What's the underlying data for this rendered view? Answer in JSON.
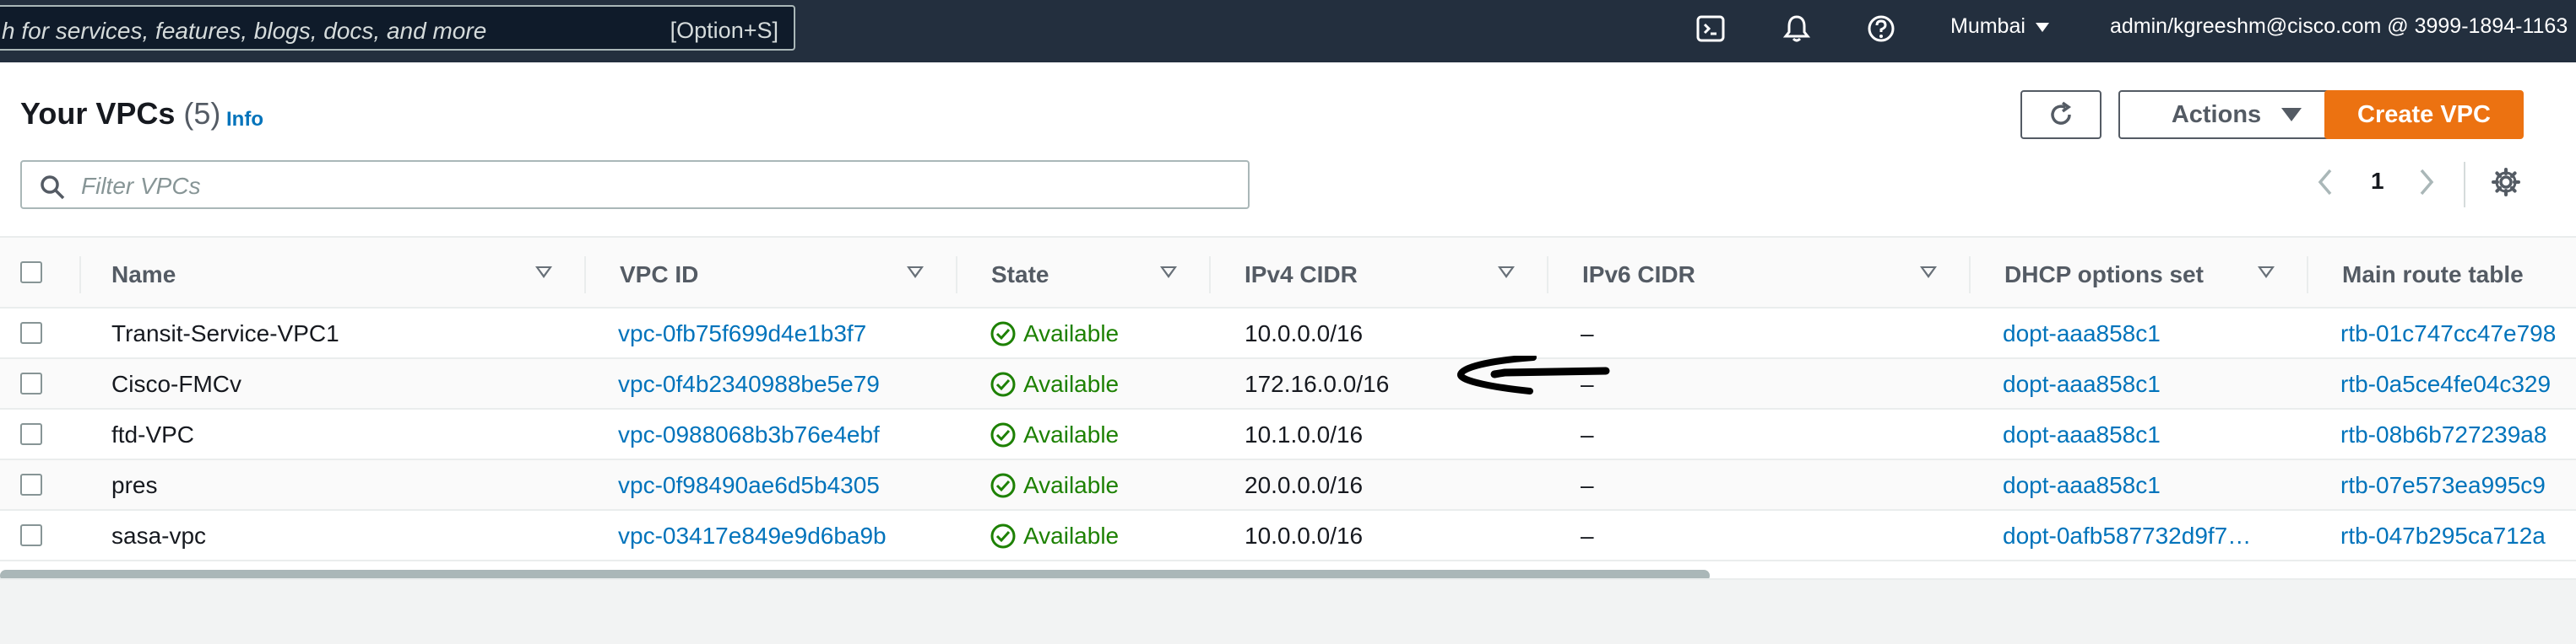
{
  "topnav": {
    "search_placeholder": "h for services, features, blogs, docs, and more",
    "search_shortcut": "[Option+S]",
    "region": "Mumbai",
    "account": "admin/kgreeshm@cisco.com @ 3999-1894-1163",
    "icons": [
      "cloudshell-icon",
      "notifications-icon",
      "help-icon"
    ]
  },
  "header": {
    "title": "Your VPCs",
    "count": "(5)",
    "info": "Info"
  },
  "actions": {
    "refresh": "refresh-icon",
    "actions_label": "Actions",
    "create_label": "Create VPC"
  },
  "filter": {
    "placeholder": "Filter VPCs"
  },
  "pagination": {
    "page": "1"
  },
  "table": {
    "columns": [
      "Name",
      "VPC ID",
      "State",
      "IPv4 CIDR",
      "IPv6 CIDR",
      "DHCP options set",
      "Main route table"
    ],
    "rows": [
      {
        "name": "Transit-Service-VPC1",
        "vpc_id": "vpc-0fb75f699d4e1b3f7",
        "state": "Available",
        "ipv4": "10.0.0.0/16",
        "ipv6": "–",
        "dhcp": "dopt-aaa858c1",
        "route": "rtb-01c747cc47e798"
      },
      {
        "name": "Cisco-FMCv",
        "vpc_id": "vpc-0f4b2340988be5e79",
        "state": "Available",
        "ipv4": "172.16.0.0/16",
        "ipv6": "–",
        "dhcp": "dopt-aaa858c1",
        "route": "rtb-0a5ce4fe04c329"
      },
      {
        "name": "ftd-VPC",
        "vpc_id": "vpc-0988068b3b76e4ebf",
        "state": "Available",
        "ipv4": "10.1.0.0/16",
        "ipv6": "–",
        "dhcp": "dopt-aaa858c1",
        "route": "rtb-08b6b727239a8"
      },
      {
        "name": "pres",
        "vpc_id": "vpc-0f98490ae6d5b4305",
        "state": "Available",
        "ipv4": "20.0.0.0/16",
        "ipv6": "–",
        "dhcp": "dopt-aaa858c1",
        "route": "rtb-07e573ea995c9"
      },
      {
        "name": "sasa-vpc",
        "vpc_id": "vpc-03417e849e9d6ba9b",
        "state": "Available",
        "ipv4": "10.0.0.0/16",
        "ipv6": "–",
        "dhcp": "dopt-0afb587732d9f7…",
        "route": "rtb-047b295ca712a"
      }
    ]
  },
  "colors": {
    "nav_bg": "#232f3e",
    "link": "#0073bb",
    "available": "#1d8102",
    "primary": "#ec7211"
  }
}
